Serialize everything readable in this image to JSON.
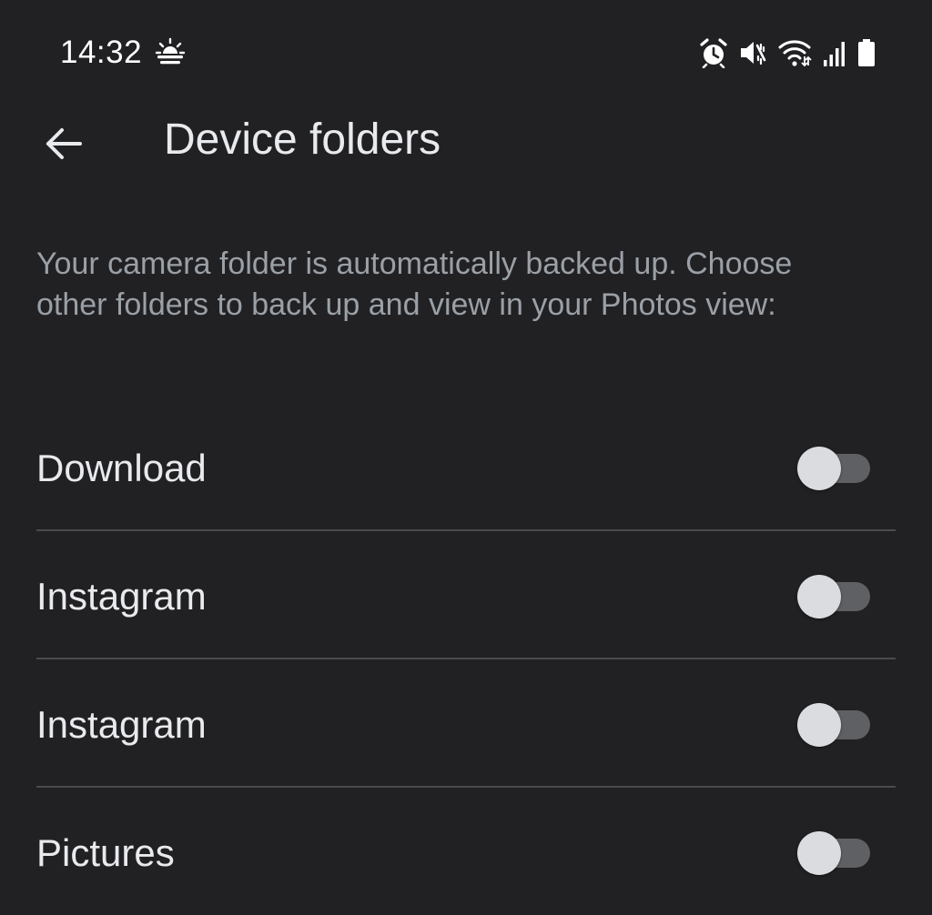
{
  "status_bar": {
    "time": "14:32",
    "icons": [
      "weather-partly-sunny-icon",
      "alarm-icon",
      "mute-icon",
      "wifi-icon",
      "signal-icon",
      "battery-icon"
    ]
  },
  "header": {
    "title": "Device folders",
    "back_icon": "arrow-back-icon"
  },
  "description": {
    "text": "Your camera folder is automatically backed up. Choose other folders to back up and view in your Photos view:"
  },
  "folders": [
    {
      "label": "Download",
      "enabled": false
    },
    {
      "label": "Instagram",
      "enabled": false
    },
    {
      "label": "Instagram",
      "enabled": false
    },
    {
      "label": "Pictures",
      "enabled": false
    }
  ],
  "colors": {
    "background": "#212124",
    "text_primary": "#e8eaed",
    "text_secondary": "#9aa0a6",
    "divider": "#4a4b4f",
    "toggle_track_off": "#5f6063",
    "toggle_thumb_off": "#dadce0"
  }
}
